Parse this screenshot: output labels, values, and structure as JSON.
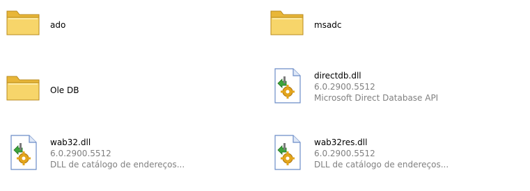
{
  "items": [
    {
      "type": "folder",
      "name": "ado",
      "icon": "folder-icon"
    },
    {
      "type": "folder",
      "name": "msadc",
      "icon": "folder-icon"
    },
    {
      "type": "folder",
      "name": "Ole DB",
      "icon": "folder-icon"
    },
    {
      "type": "file",
      "name": "directdb.dll",
      "version": "6.0.2900.5512",
      "description": "Microsoft Direct Database API",
      "icon": "dll-file-icon"
    },
    {
      "type": "file",
      "name": "wab32.dll",
      "version": "6.0.2900.5512",
      "description": "DLL de catálogo de endereços...",
      "icon": "dll-file-icon"
    },
    {
      "type": "file",
      "name": "wab32res.dll",
      "version": "6.0.2900.5512",
      "description": "DLL de catálogo de endereços...",
      "icon": "dll-file-icon"
    }
  ],
  "colors": {
    "folder_fill": "#f7d56a",
    "folder_edge": "#b98a1c",
    "file_page": "#ffffff",
    "file_edge": "#6b8cc7",
    "gear": "#e3a51c",
    "green_arrow": "#3ca53c",
    "secondary_text": "#808080"
  }
}
